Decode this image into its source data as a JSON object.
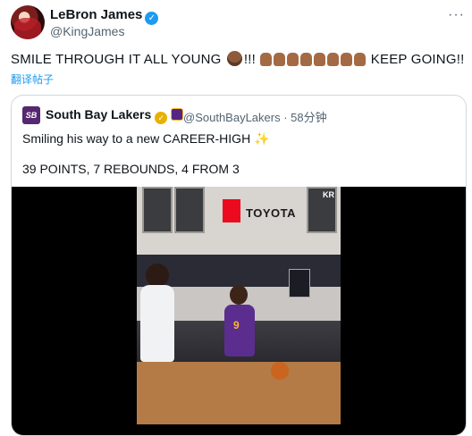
{
  "tweet": {
    "author_name": "LeBron James",
    "author_handle": "@KingJames",
    "text_part1": "SMILE THROUGH IT ALL YOUNG",
    "text_part2": "!!!",
    "text_part3": "KEEP GOING!!",
    "translate_label": "翻译帖子"
  },
  "quote": {
    "logo_text": "SB",
    "author_name": "South Bay Lakers",
    "handle_time": "@SouthBayLakers · 58分钟",
    "line1": "Smiling his way to a new CAREER-HIGH",
    "sparkle": "✨",
    "line2": "39 POINTS, 7 REBOUNDS, 4 FROM 3"
  },
  "video": {
    "sponsor": "TOYOTA",
    "jersey_number": "9",
    "watermark": "KR"
  },
  "icons": {
    "verified": "✓",
    "more": "···",
    "gold": "✓"
  },
  "colors": {
    "link": "#1d9bf0",
    "verified": "#1d9bf0",
    "lakers_purple": "#552583",
    "lakers_gold": "#fdb927"
  }
}
